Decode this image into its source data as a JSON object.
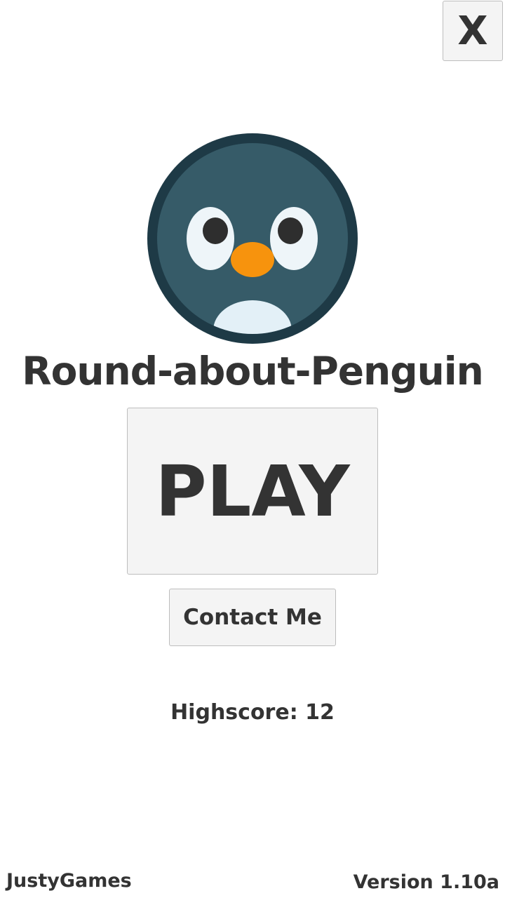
{
  "close_button": {
    "label": "X"
  },
  "game": {
    "title": "Round-about-Penguin",
    "play_label": "PLAY",
    "contact_label": "Contact Me",
    "highscore_label": "Highscore:",
    "highscore_value": "12"
  },
  "footer": {
    "brand": "JustyGames",
    "version": "Version 1.10a"
  },
  "colors": {
    "background": "#ffffff",
    "text": "#333333",
    "button_bg": "#f4f4f4",
    "button_border": "#bdbdbd",
    "penguin_ring": "#1e3a46",
    "penguin_body": "#365b68",
    "penguin_eye": "#eef5f9",
    "penguin_pupil": "#2e2e2e",
    "penguin_beak": "#f7930d",
    "penguin_belly": "#e3f0f7"
  },
  "icons": {
    "logo": "penguin-face-icon"
  }
}
